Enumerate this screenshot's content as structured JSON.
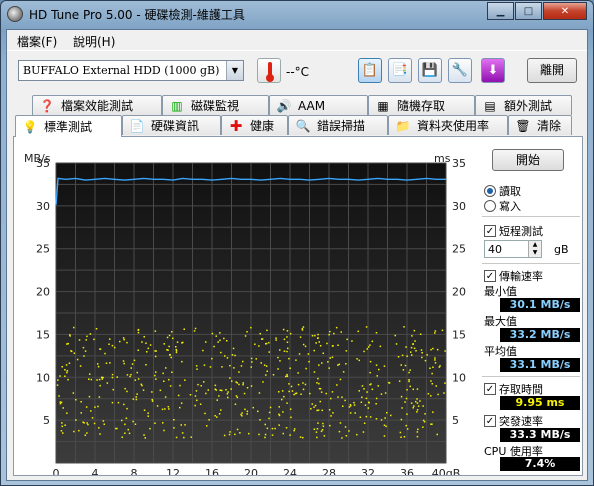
{
  "window": {
    "title": "HD Tune Pro  5.00 - 硬碟檢測-維護工具"
  },
  "menu": [
    {
      "label": "檔案(F)"
    },
    {
      "label": "說明(H)"
    }
  ],
  "toolbar": {
    "drive": "BUFFALO External HDD     (1000 gB)",
    "temperature": "--°C",
    "exit_label": "離開"
  },
  "tabs_top": [
    {
      "label": "檔案效能測試",
      "icon": "file-benchmark-icon"
    },
    {
      "label": "磁碟監視",
      "icon": "disk-monitor-icon"
    },
    {
      "label": "AAM",
      "icon": "speaker-icon"
    },
    {
      "label": "隨機存取",
      "icon": "random-access-icon"
    },
    {
      "label": "額外測試",
      "icon": "extra-tests-icon"
    }
  ],
  "tabs_bottom": [
    {
      "label": "標準測試",
      "icon": "benchmark-bulb-icon",
      "active": true
    },
    {
      "label": "硬碟資訊",
      "icon": "info-icon"
    },
    {
      "label": "健康",
      "icon": "health-cross-icon"
    },
    {
      "label": "錯誤掃描",
      "icon": "magnifier-icon"
    },
    {
      "label": "資料夾使用率",
      "icon": "folder-icon"
    },
    {
      "label": "清除",
      "icon": "trash-icon"
    }
  ],
  "panel": {
    "start_label": "開始",
    "read_label": "讀取",
    "write_label": "寫入",
    "short_test_label": "短程測試",
    "short_test_value": "40",
    "short_test_unit": "gB",
    "transfer_rate_label": "傳輸速率",
    "min_label": "最小值",
    "min_value": "30.1 MB/s",
    "max_label": "最大值",
    "max_value": "33.2 MB/s",
    "avg_label": "平均值",
    "avg_value": "33.1 MB/s",
    "access_time_label": "存取時間",
    "access_time_value": "9.95 ms",
    "burst_rate_label": "突發速率",
    "burst_rate_value": "33.3 MB/s",
    "cpu_label": "CPU 使用率",
    "cpu_value": "7.4%"
  },
  "chart_data": {
    "type": "line",
    "left_unit": "MB/s",
    "right_unit": "ms",
    "x_unit_suffix": "gB",
    "xlim": [
      0,
      40
    ],
    "ylim_left": [
      0,
      35
    ],
    "ylim_right": [
      0,
      35
    ],
    "x_ticks": [
      0,
      4,
      8,
      12,
      16,
      20,
      24,
      28,
      32,
      36,
      40
    ],
    "y_ticks": [
      5,
      10,
      15,
      20,
      25,
      30,
      35
    ],
    "grid": true,
    "series": [
      {
        "name": "讀取",
        "color": "#3aa7ff",
        "x": [
          0,
          0.2,
          1,
          2,
          3,
          4,
          5,
          6,
          7,
          8,
          9,
          10,
          11,
          12,
          13,
          14,
          15,
          16,
          17,
          18,
          19,
          20,
          21,
          22,
          23,
          24,
          25,
          26,
          27,
          28,
          29,
          30,
          31,
          32,
          33,
          34,
          35,
          36,
          37,
          38,
          39,
          40
        ],
        "y": [
          30.1,
          33.2,
          33.1,
          33.2,
          33.0,
          33.1,
          33.2,
          33.1,
          33.0,
          33.1,
          33.2,
          33.1,
          33.1,
          33.0,
          33.2,
          33.1,
          33.1,
          33.0,
          33.1,
          33.2,
          33.1,
          33.1,
          33.0,
          33.1,
          33.2,
          33.1,
          33.1,
          33.0,
          33.1,
          33.2,
          33.1,
          33.1,
          33.0,
          33.1,
          33.2,
          33.1,
          33.1,
          33.0,
          33.1,
          33.2,
          33.1,
          33.1
        ]
      }
    ],
    "access_scatter": {
      "color": "#f4f000",
      "axis": "right",
      "y_range_ms": [
        3,
        16
      ],
      "x_range": [
        0,
        40
      ],
      "count": 620
    }
  }
}
